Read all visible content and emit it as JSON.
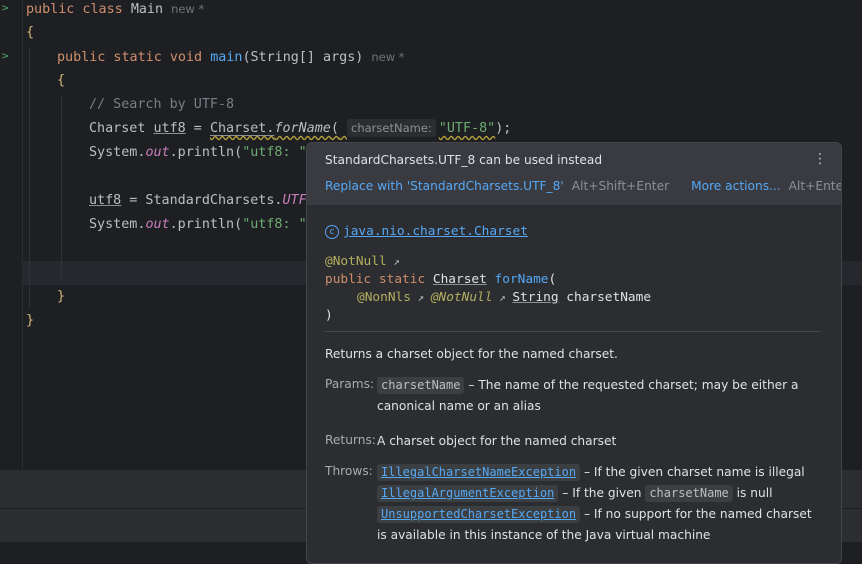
{
  "editor": {
    "lines": {
      "l1": {
        "kw1": "public class",
        "name": "Main",
        "badge": "new *"
      },
      "l2": {
        "brace": "{"
      },
      "l3": {
        "kw": "public static void",
        "fn": "main",
        "args_pre": "(String[] args)",
        "badge": "new *"
      },
      "l4": {
        "brace": "{"
      },
      "l5": {
        "comment": "// Search by UTF-8"
      },
      "l6": {
        "type": "Charset",
        "var": "utf8",
        "eq": " = ",
        "cls": "Charset.",
        "method": "forName",
        "paren": "(",
        "hint": "charsetName:",
        "str": "\"UTF-8\"",
        "end": ");"
      },
      "l7": {
        "sys": "System.",
        "out": "out",
        "rest": ".println(",
        "str": "\"utf8: \""
      },
      "l9": {
        "var": "utf8",
        "rest": " = StandardCharsets.",
        "field": "UTF"
      },
      "l10": {
        "sys": "System.",
        "out": "out",
        "rest": ".println(",
        "str": "\"utf8: \""
      },
      "l12": {
        "brace": "}"
      },
      "l13": {
        "brace": "}"
      }
    }
  },
  "popup": {
    "warning": "StandardCharsets.UTF_8 can be used instead",
    "fix_label": "Replace with 'StandardCharsets.UTF_8'",
    "fix_shortcut": "Alt+Shift+Enter",
    "more_label": "More actions...",
    "more_shortcut": "Alt+Enter",
    "doc": {
      "class_link": "java.nio.charset.Charset",
      "annotation1": "@NotNull",
      "sig_kw": "public static",
      "sig_type": "Charset",
      "sig_fn": "forName",
      "sig_paren": "(",
      "param_annot1": "@NonNls",
      "param_annot2": "@NotNull",
      "param_type": "String",
      "param_name": "charsetName",
      "close_paren": ")",
      "description": "Returns a charset object for the named charset.",
      "params_label": "Params:",
      "param_chip": "charsetName",
      "param_desc": "– The name of the requested charset; may be either a canonical name or an alias",
      "returns_label": "Returns:",
      "returns_desc": "A charset object for the named charset",
      "throws_label": "Throws:",
      "throws": [
        {
          "exception": "IllegalCharsetNameException",
          "pre": "– If the given charset name is illegal",
          "chip": "",
          "post": ""
        },
        {
          "exception": "IllegalArgumentException",
          "pre": "– If the given",
          "chip": "charsetName",
          "post": "is null"
        },
        {
          "exception": "UnsupportedCharsetException",
          "pre": "– If no support for the named charset is available in this instance of the Java virtual machine",
          "chip": "",
          "post": ""
        }
      ]
    }
  }
}
